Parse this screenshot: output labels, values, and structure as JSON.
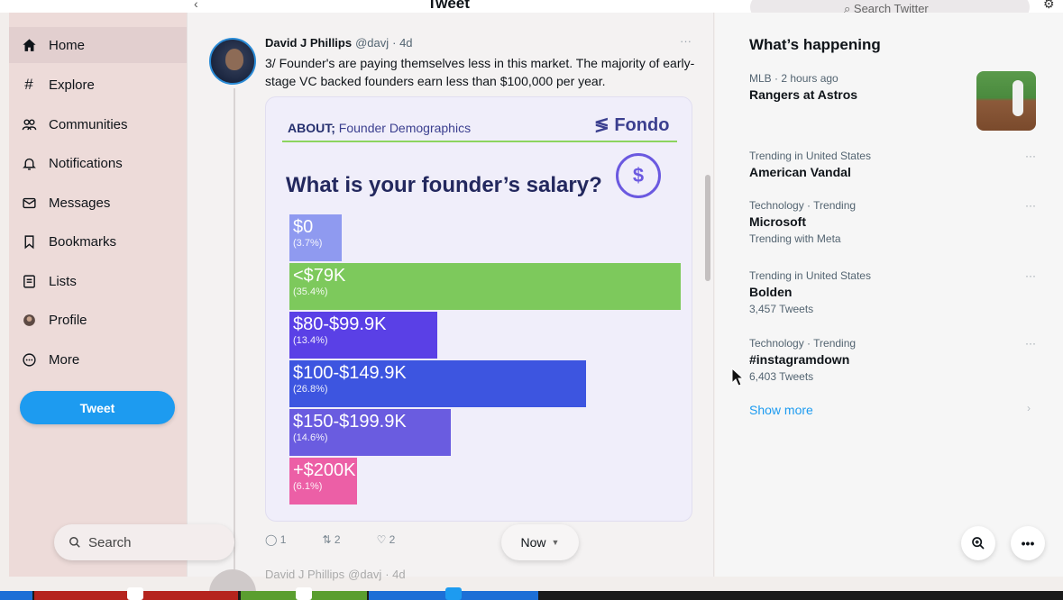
{
  "topbar": {
    "title": "Tweet",
    "search_placeholder": "Search Twitter"
  },
  "sidebar": {
    "items": [
      {
        "label": "Home",
        "icon": "home-icon",
        "active": true
      },
      {
        "label": "Explore",
        "icon": "hashtag-icon"
      },
      {
        "label": "Communities",
        "icon": "communities-icon"
      },
      {
        "label": "Notifications",
        "icon": "bell-icon"
      },
      {
        "label": "Messages",
        "icon": "envelope-icon"
      },
      {
        "label": "Bookmarks",
        "icon": "bookmark-icon"
      },
      {
        "label": "Lists",
        "icon": "list-icon"
      },
      {
        "label": "Profile",
        "icon": "profile-avatar-icon"
      },
      {
        "label": "More",
        "icon": "more-circle-icon"
      }
    ],
    "tweet_button": "Tweet"
  },
  "tweet": {
    "author": "David J Phillips",
    "handle": "@davj",
    "time": "· 4d",
    "more": "···",
    "text": "3/ Founder's are paying themselves less in this market. The majority of early-stage VC backed founders earn less than $100,000 per year.",
    "actions": {
      "replies": "1",
      "retweets": "2",
      "likes": "2"
    }
  },
  "card": {
    "about_bold": "ABOUT;",
    "about_rest": " Founder Demographics",
    "brand": "Fondo",
    "brand_mark": "≶",
    "bubble_symbol": "$"
  },
  "chart_data": {
    "type": "bar",
    "title": "What is your founder’s salary?",
    "orientation": "horizontal",
    "categories": [
      "$0",
      "<$79K",
      "$80-$99.9K",
      "$100-$149.9K",
      "$150-$199.9K",
      "+$200K"
    ],
    "values": [
      3.7,
      35.4,
      13.4,
      26.8,
      14.6,
      6.1
    ],
    "value_labels": [
      "(3.7%)",
      "(35.4%)",
      "(13.4%)",
      "(26.8%)",
      "(14.6%)",
      "(6.1%)"
    ],
    "colors": [
      "#8f9af0",
      "#7dc95c",
      "#5a40e6",
      "#3d55e0",
      "#6a5ce0",
      "#ec5fa6"
    ],
    "xlim": [
      0,
      35.4
    ]
  },
  "next_tweet": {
    "author": "David J Phillips",
    "handle": "@davj",
    "time": "· 4d"
  },
  "right": {
    "title": "What’s happening",
    "trends": [
      {
        "meta": "MLB · 2 hours ago",
        "name": "Rangers at Astros",
        "sub": ""
      },
      {
        "meta": "Trending in United States",
        "name": "American Vandal",
        "sub": ""
      },
      {
        "meta": "Technology · Trending",
        "name": "Microsoft",
        "sub": "Trending with Meta"
      },
      {
        "meta": "Trending in United States",
        "name": "Bolden",
        "sub": "3,457 Tweets"
      },
      {
        "meta": "Technology · Trending",
        "name": "#instagramdown",
        "sub": "6,403 Tweets"
      }
    ],
    "show_more": "Show more",
    "trend_dots": "···",
    "arrow": "›"
  },
  "overlay": {
    "search_label": "Search",
    "now_label": "Now",
    "more_label": "•••"
  },
  "colors": {
    "accent": "#1d9bf0",
    "sidebar_bg": "#eddbd9"
  }
}
